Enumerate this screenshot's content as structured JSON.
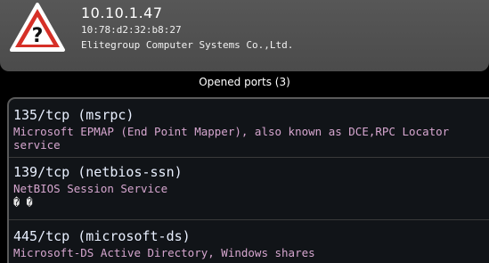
{
  "host": {
    "ip": "10.10.1.47",
    "mac": "10:78:d2:32:b8:27",
    "vendor": "Elitegroup Computer Systems Co.,Ltd.",
    "status_icon": "warning-question-icon"
  },
  "ports_section": {
    "title": "Opened ports (3)"
  },
  "ports": [
    {
      "title": "135/tcp (msrpc)",
      "description": "Microsoft EPMAP (End Point Mapper), also known as DCE,RPC Locator service",
      "extra": ""
    },
    {
      "title": "139/tcp (netbios-ssn)",
      "description": "NetBIOS Session Service",
      "extra": "� �"
    },
    {
      "title": "445/tcp (microsoft-ds)",
      "description": "Microsoft-DS Active Directory, Windows shares",
      "extra": ""
    }
  ],
  "colors": {
    "header_bg": "#505050",
    "port_title": "#e9f0ff",
    "port_desc": "#d6a6cf",
    "warning_red": "#d63027"
  }
}
